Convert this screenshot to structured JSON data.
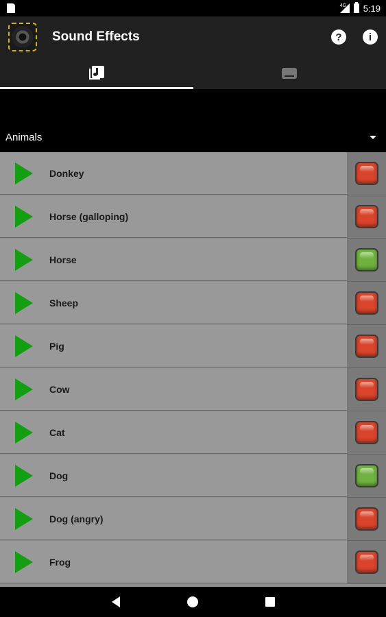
{
  "status_bar": {
    "time": "5:19",
    "network": "4G"
  },
  "app": {
    "title": "Sound Effects"
  },
  "toolbar": {
    "help_label": "?",
    "info_label": "i"
  },
  "tabs": [
    {
      "icon": "music-library-icon",
      "active": true
    },
    {
      "icon": "keyboard-icon",
      "active": false
    }
  ],
  "category": {
    "selected": "Animals"
  },
  "colors": {
    "play": "#12a012",
    "red": "#d9442a",
    "green": "#6fb23e"
  },
  "sounds": [
    {
      "label": "Donkey",
      "state": "red"
    },
    {
      "label": "Horse (galloping)",
      "state": "red"
    },
    {
      "label": "Horse",
      "state": "green"
    },
    {
      "label": "Sheep",
      "state": "red"
    },
    {
      "label": "Pig",
      "state": "red"
    },
    {
      "label": "Cow",
      "state": "red"
    },
    {
      "label": "Cat",
      "state": "red"
    },
    {
      "label": "Dog",
      "state": "green"
    },
    {
      "label": "Dog (angry)",
      "state": "red"
    },
    {
      "label": "Frog",
      "state": "red"
    }
  ]
}
